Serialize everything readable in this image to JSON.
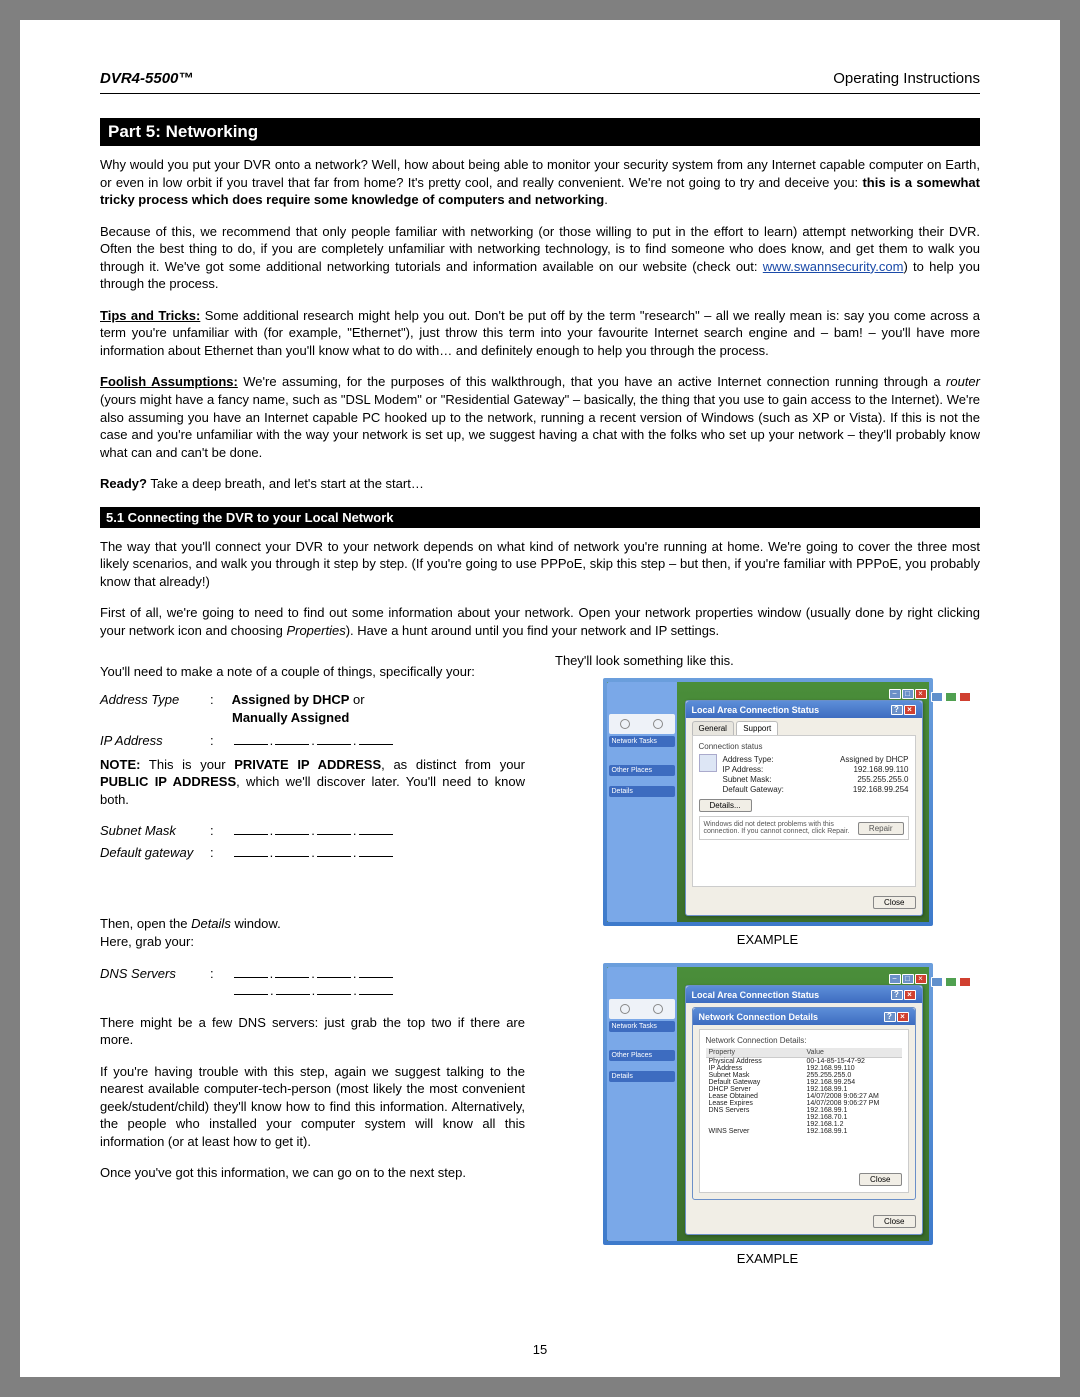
{
  "header": {
    "left": "DVR4-5500™",
    "right": "Operating Instructions"
  },
  "part_banner": "Part 5: Networking",
  "p1a": "Why would you put your DVR onto a network? Well, how about being able to monitor your security system from any Internet capable computer on Earth, or even in low orbit if you travel that far from home? It's pretty cool, and really convenient. We're not going to try and deceive you: ",
  "p1b": "this is a somewhat tricky process which does require some knowledge of computers and networking",
  "p1c": ".",
  "p2a": "Because of this, we recommend that only people familiar with networking (or those willing to put in the effort to learn) attempt networking their DVR. Often the best thing to do, if you are completely unfamiliar with networking technology, is to find someone who does know, and get them to walk you through it. We've got some additional networking tutorials and information available on our website (check out: ",
  "p2link": "www.swannsecurity.com",
  "p2b": ") to help you through the process.",
  "p3label": "Tips and Tricks:",
  "p3": " Some additional research might help you out. Don't be put off by the term \"research\" – all we really mean is: say you come across a term you're unfamiliar with (for example, \"Ethernet\"), just throw this term into your favourite Internet search engine and – bam! – you'll have more information about Ethernet than you'll know what to do with… and definitely enough to help you through the process.",
  "p4label": "Foolish Assumptions:",
  "p4a": " We're assuming, for the purposes of this walkthrough, that you have an active Internet connection running through a ",
  "p4router": "router",
  "p4b": " (yours might have a fancy name, such as \"DSL Modem\" or \"Residential Gateway\" – basically, the thing that you use to gain access to the Internet). We're also assuming you have an Internet capable PC hooked up to the network, running a recent version of Windows (such as XP or Vista). If this is not the case and you're unfamiliar with the way your network is set up, we suggest having a chat with the folks who set up your network – they'll probably know what can and can't be done.",
  "p5a": "Ready?",
  "p5b": " Take a deep breath, and let's start at the start…",
  "sub_banner": "5.1 Connecting the DVR to your Local Network",
  "p6": "The way that you'll connect your DVR to your network depends on what kind of network you're running at home. We're going to cover the three most likely scenarios, and walk you through it step by step. (If you're going to use PPPoE, skip this step – but then, if you're familiar with PPPoE, you probably know that already!)",
  "p7a": "First of all, we're going to need to find out some information about your network. Open your network properties window (usually done by right clicking your network icon and choosing ",
  "p7b": "Properties",
  "p7c": "). Have a hunt around until you find your network and IP settings.",
  "col_right_intro": "They'll look something like this.",
  "col_left_intro": "You'll need to make a note of a couple of things, specifically your:",
  "fields": {
    "address_type_label": "Address Type",
    "address_type_val1": "Assigned by DHCP",
    "address_type_or": " or",
    "address_type_val2": "Manually Assigned",
    "ip_label": "IP Address",
    "note_label": "NOTE:",
    "note_a": " This is your ",
    "note_b": "PRIVATE IP ADDRESS",
    "note_c": ", as distinct from your ",
    "note_d": "PUBLIC IP ADDRESS",
    "note_e": ", which we'll discover later. You'll need to know both.",
    "subnet_label": "Subnet Mask",
    "gateway_label": "Default gateway",
    "details_open_a": "Then, open the ",
    "details_open_b": "Details",
    "details_open_c": " window.",
    "here_grab": "Here, grab your:",
    "dns_label": "DNS Servers",
    "dns_note": "There might be a few DNS servers: just grab the top two if there are more.",
    "trouble": "If you're having trouble with this step, again we suggest talking to the nearest available computer-tech-person (most likely the most convenient geek/student/child) they'll know how to find this information. Alternatively, the people who installed your computer system will know all this information (or at least how to get it).",
    "once": "Once you've got this information, we can go on to the next step."
  },
  "example_caption": "EXAMPLE",
  "page_number": "15",
  "shot1": {
    "sidebar": {
      "item1": "Network Tasks",
      "item2": "Other Places",
      "item3": "Details"
    },
    "dialog_title": "Local Area Connection Status",
    "tab1": "General",
    "tab2": "Support",
    "group": "Connection status",
    "rows": {
      "address_type_k": "Address Type:",
      "address_type_v": "Assigned by DHCP",
      "ip_k": "IP Address:",
      "ip_v": "192.168.99.110",
      "subnet_k": "Subnet Mask:",
      "subnet_v": "255.255.255.0",
      "gateway_k": "Default Gateway:",
      "gateway_v": "192.168.99.254"
    },
    "details_btn": "Details...",
    "repair_text": "Windows did not detect problems with this connection. If you cannot connect, click Repair.",
    "repair_btn": "Repair",
    "close_btn": "Close"
  },
  "shot2": {
    "sidebar": {
      "item1": "Network Tasks",
      "item2": "Other Places",
      "item3": "Details"
    },
    "outer_title": "Local Area Connection Status",
    "dialog_title": "Network Connection Details",
    "header_k": "Property",
    "header_v": "Value",
    "rows": [
      {
        "k": "Physical Address",
        "v": "00-14-85-15-47-92"
      },
      {
        "k": "IP Address",
        "v": "192.168.99.110"
      },
      {
        "k": "Subnet Mask",
        "v": "255.255.255.0"
      },
      {
        "k": "Default Gateway",
        "v": "192.168.99.254"
      },
      {
        "k": "DHCP Server",
        "v": "192.168.99.1"
      },
      {
        "k": "Lease Obtained",
        "v": "14/07/2008 9:06:27 AM"
      },
      {
        "k": "Lease Expires",
        "v": "14/07/2008 9:06:27 PM"
      },
      {
        "k": "DNS Servers",
        "v": "192.168.99.1"
      },
      {
        "k": "",
        "v": "192.168.70.1"
      },
      {
        "k": "",
        "v": "192.168.1.2"
      },
      {
        "k": "WINS Server",
        "v": "192.168.99.1"
      }
    ],
    "close_btn": "Close",
    "outer_close": "Close"
  }
}
